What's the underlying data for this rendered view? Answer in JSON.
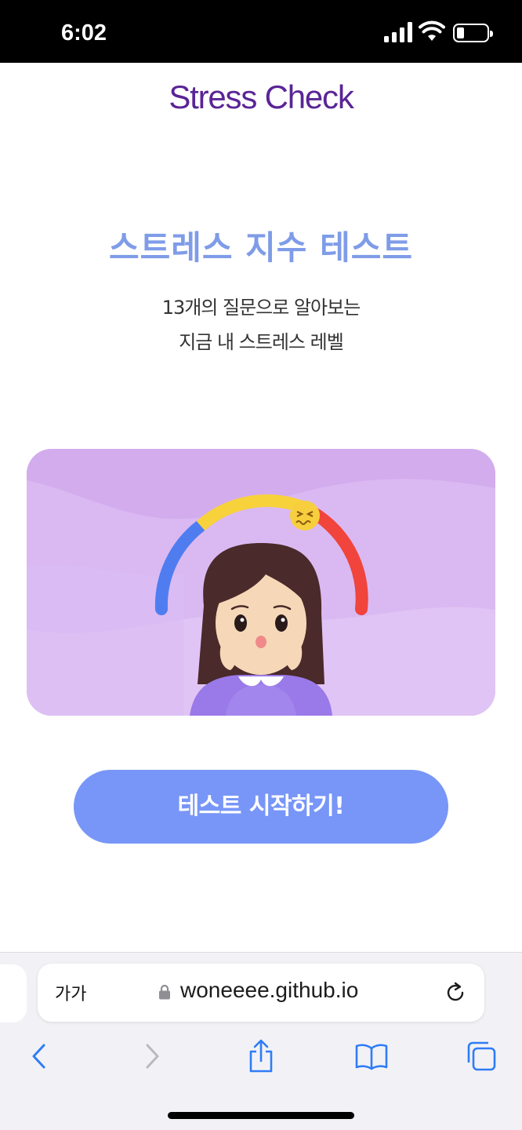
{
  "status_bar": {
    "time": "6:02"
  },
  "header": {
    "app_title": "Stress Check"
  },
  "intro": {
    "title": "스트레스 지수 테스트",
    "subtitle_line1": "13개의 질문으로 알아보는",
    "subtitle_line2": "지금 내 스트레스 레벨"
  },
  "start_button": {
    "label": "테스트 시작하기!"
  },
  "browser": {
    "reader_label": "가가",
    "url": "woneeee.github.io"
  },
  "icons": [
    "signal-icon",
    "wifi-icon",
    "battery-icon",
    "lock-icon",
    "reload-icon",
    "back-icon",
    "forward-icon",
    "share-icon",
    "bookmarks-icon",
    "tabs-icon"
  ],
  "colors": {
    "app_title": "#5a2596",
    "main_title": "#7f9ce8",
    "button_bg": "#7896f7",
    "card_bg": "#d6afef",
    "gauge_blue": "#4f7df0",
    "gauge_yellow": "#f7d23a",
    "gauge_red": "#f0443c"
  }
}
